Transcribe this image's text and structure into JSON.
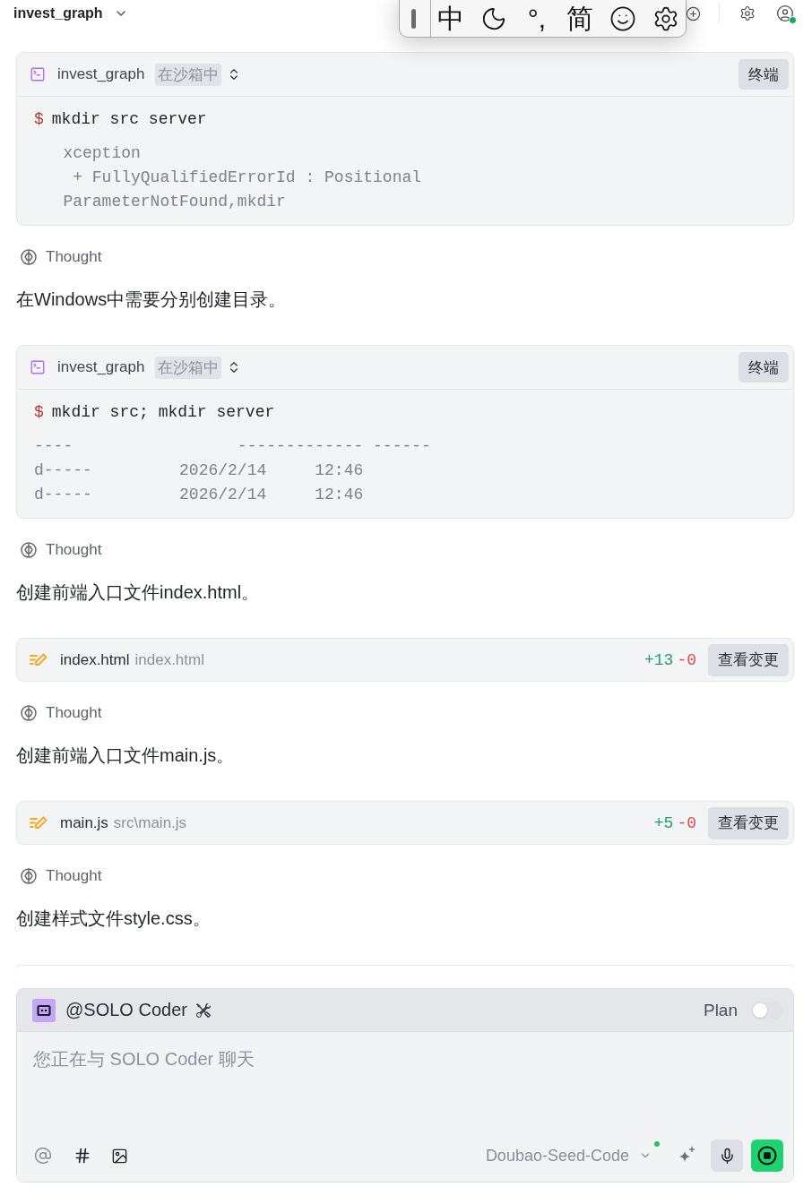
{
  "top_bar": {
    "project": "invest_graph"
  },
  "ime_toolbar": {
    "input_mode": "中",
    "punctuation": "°,",
    "character_set": "简"
  },
  "feed": [
    {
      "kind": "terminal",
      "project": "invest_graph",
      "badge": "在沙箱中",
      "button": "终端",
      "prompt": "$",
      "command": "mkdir src server",
      "output": [
        "   xception",
        "    + FullyQualifiedErrorId : Positional",
        "   ParameterNotFound,mkdir"
      ]
    },
    {
      "kind": "thought",
      "label": "Thought"
    },
    {
      "kind": "message",
      "text": "在Windows中需要分别创建目录。"
    },
    {
      "kind": "terminal",
      "project": "invest_graph",
      "badge": "在沙箱中",
      "button": "终端",
      "prompt": "$",
      "command": "mkdir src; mkdir server",
      "output": [
        "----                 ------------- ------",
        "d-----         2026/2/14     12:46",
        "d-----         2026/2/14     12:46"
      ]
    },
    {
      "kind": "thought",
      "label": "Thought"
    },
    {
      "kind": "message",
      "text": "创建前端入口文件index.html。"
    },
    {
      "kind": "file_edit",
      "file": "index.html",
      "path": "index.html",
      "added": "+13",
      "removed": "-0",
      "button": "查看变更"
    },
    {
      "kind": "thought",
      "label": "Thought"
    },
    {
      "kind": "message",
      "text": "创建前端入口文件main.js。"
    },
    {
      "kind": "file_edit",
      "file": "main.js",
      "path": "src\\main.js",
      "added": "+5",
      "removed": "-0",
      "button": "查看变更"
    },
    {
      "kind": "thought",
      "label": "Thought"
    },
    {
      "kind": "message",
      "text": "创建样式文件style.css。"
    }
  ],
  "composer": {
    "agent": "@SOLO Coder",
    "plan": {
      "label": "Plan",
      "on": false
    },
    "placeholder": "您正在与 SOLO Coder 聊天",
    "model": "Doubao-Seed-Code"
  }
}
